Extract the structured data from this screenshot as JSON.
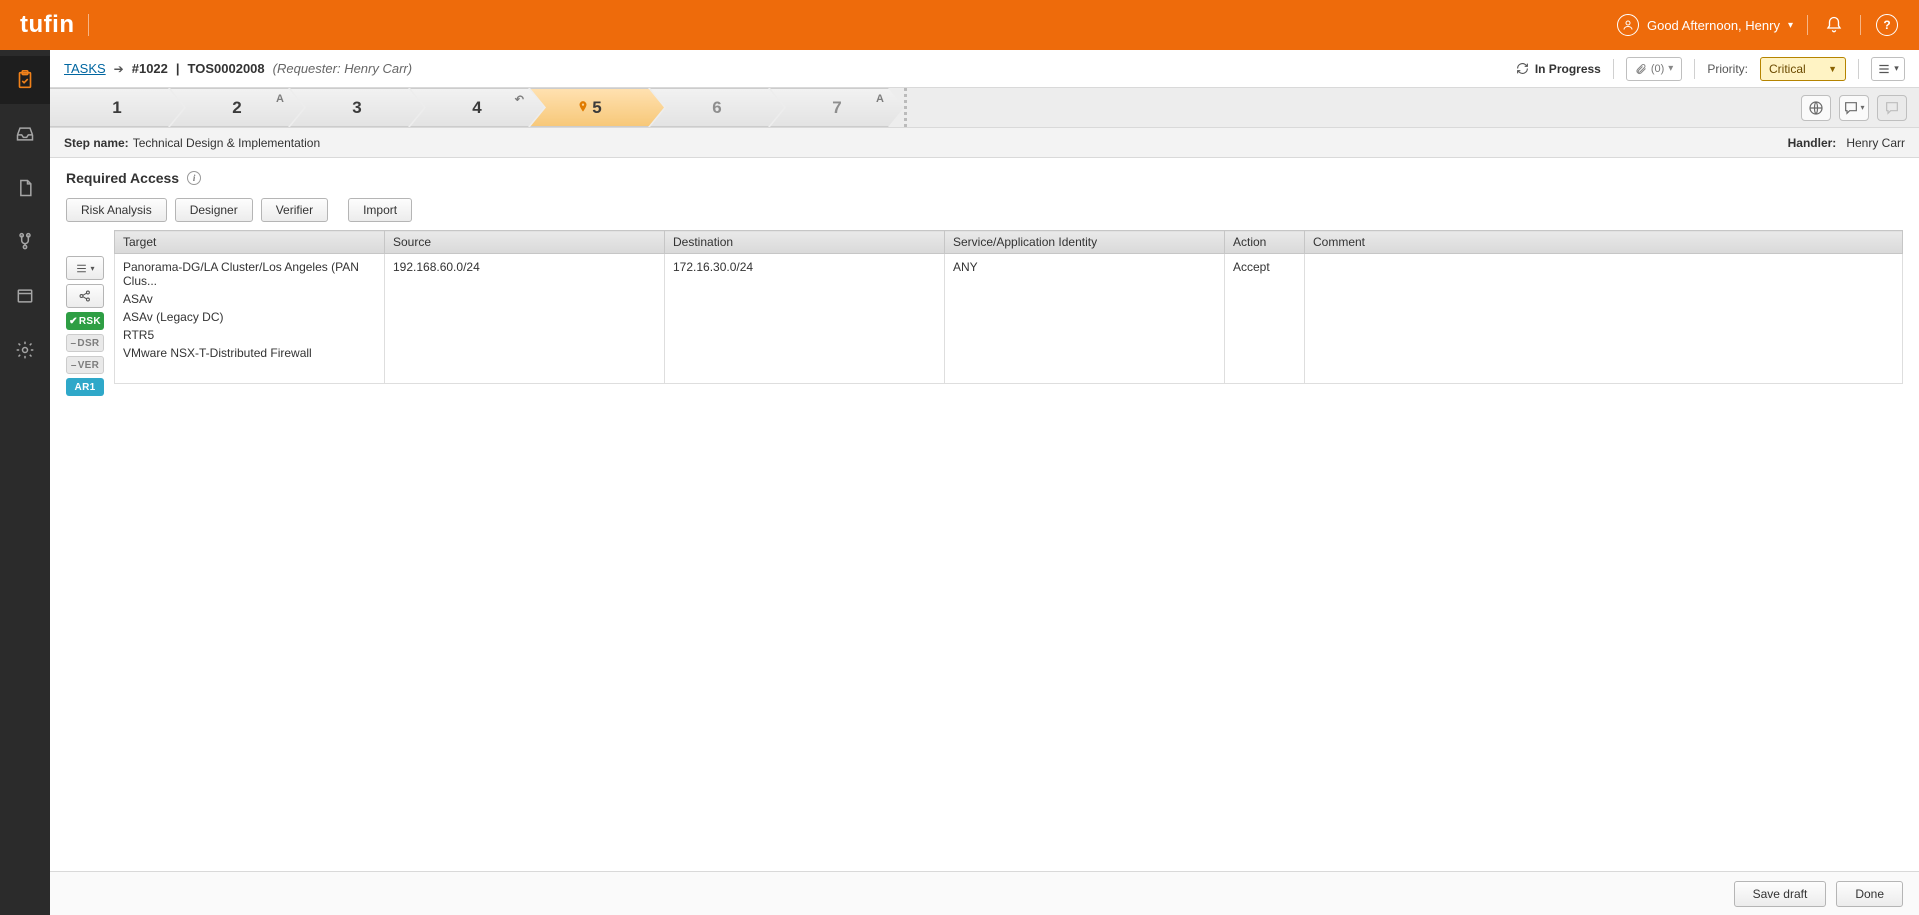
{
  "brand": "tufin",
  "user_greeting": "Good Afternoon, Henry",
  "breadcrumb": {
    "tasks_label": "TASKS",
    "ticket_id": "#1022",
    "ticket_ref": "TOS0002008",
    "requester_prefix": "(Requester: ",
    "requester_name": "Henry Carr",
    "requester_suffix": ")"
  },
  "status": {
    "label": "In Progress"
  },
  "attachment": {
    "count_label": "(0)"
  },
  "priority": {
    "label": "Priority:",
    "value": "Critical"
  },
  "steps": {
    "items": [
      {
        "num": "1"
      },
      {
        "num": "2",
        "mark": "A"
      },
      {
        "num": "3"
      },
      {
        "num": "4",
        "mark": "↶"
      },
      {
        "num": "5",
        "active": true,
        "pin": true
      },
      {
        "num": "6"
      },
      {
        "num": "7",
        "mark": "A"
      }
    ]
  },
  "step_meta": {
    "name_label": "Step name:",
    "name_value": "Technical Design & Implementation",
    "handler_label": "Handler:",
    "handler_value": "Henry Carr"
  },
  "section": {
    "title": "Required Access"
  },
  "actions": {
    "risk": "Risk Analysis",
    "designer": "Designer",
    "verifier": "Verifier",
    "import": "Import"
  },
  "badges": {
    "rsk": "RSK",
    "dsr": "DSR",
    "ver": "VER",
    "ar1": "AR1"
  },
  "grid": {
    "headers": {
      "target": "Target",
      "source": "Source",
      "destination": "Destination",
      "service": "Service/Application Identity",
      "action": "Action",
      "comment": "Comment"
    },
    "row": {
      "targets": [
        "Panorama-DG/LA Cluster/Los Angeles (PAN Clus...",
        "ASAv",
        "ASAv (Legacy DC)",
        "RTR5",
        "VMware NSX-T-Distributed Firewall"
      ],
      "source": "192.168.60.0/24",
      "destination": "172.16.30.0/24",
      "service": "ANY",
      "action": "Accept",
      "comment": ""
    }
  },
  "footer": {
    "save": "Save draft",
    "done": "Done"
  }
}
